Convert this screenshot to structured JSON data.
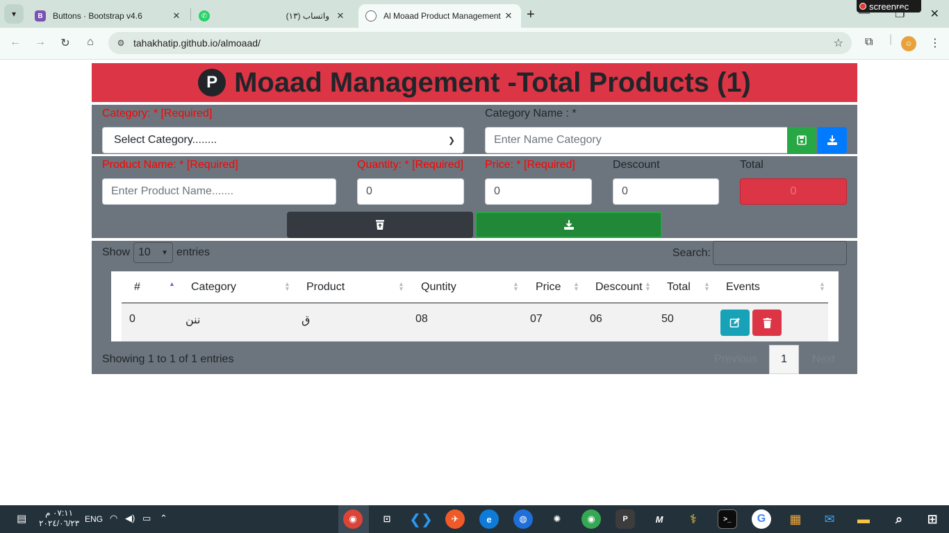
{
  "browser": {
    "tabs": [
      {
        "title": "Buttons · Bootstrap v4.6",
        "favicon": "B",
        "favicon_color": "#7952b3"
      },
      {
        "title": "(١٣) واتساب",
        "favicon": "whatsapp-icon",
        "favicon_color": "#25d366"
      },
      {
        "title": "Al Moaad Product Management",
        "favicon": "globe-icon",
        "favicon_color": "#5f6368",
        "active": true
      }
    ],
    "url": "tahakhatip.github.io/almoaad/",
    "recorder_label": "screenrec"
  },
  "header": {
    "logo": "P",
    "title": "Moaad Management -Total Products (1)"
  },
  "category_form": {
    "category_label": "Category: * [Required]",
    "category_select": "Select Category........",
    "category_name_label": "Category Name : *",
    "category_name_placeholder": "Enter Name Category"
  },
  "product_form": {
    "product_label": "Product Name: * [Required]",
    "product_placeholder": "Enter Product Name.......",
    "quantity_label": "Quantity: * [Required]",
    "quantity_value": "0",
    "price_label": "Price: * [Required]",
    "price_value": "0",
    "discount_label": "Descount",
    "discount_value": "0",
    "total_label": "Total",
    "total_value": "0"
  },
  "table": {
    "show_label": "Show",
    "entries_value": "10",
    "entries_label": "entries",
    "search_label": "Search:",
    "columns": [
      "#",
      "Category",
      "Product",
      "Quntity",
      "Price",
      "Descount",
      "Total",
      "Events"
    ],
    "rows": [
      {
        "id": "0",
        "category": "ننن",
        "product": "ق",
        "quantity": "08",
        "price": "07",
        "discount": "06",
        "total": "50"
      }
    ],
    "info": "Showing 1 to 1 of 1 entries",
    "previous": "Previous",
    "page": "1",
    "next": "Next"
  },
  "taskbar": {
    "time": "٠٧:١١ م",
    "date": "٢٠٢٤/٠٦/٢٣",
    "lang": "ENG"
  },
  "colors": {
    "danger": "#dc3545",
    "success": "#28a745",
    "primary": "#007bff",
    "info": "#17a2b8",
    "dark": "#343a40",
    "secondary": "#6c757d"
  }
}
